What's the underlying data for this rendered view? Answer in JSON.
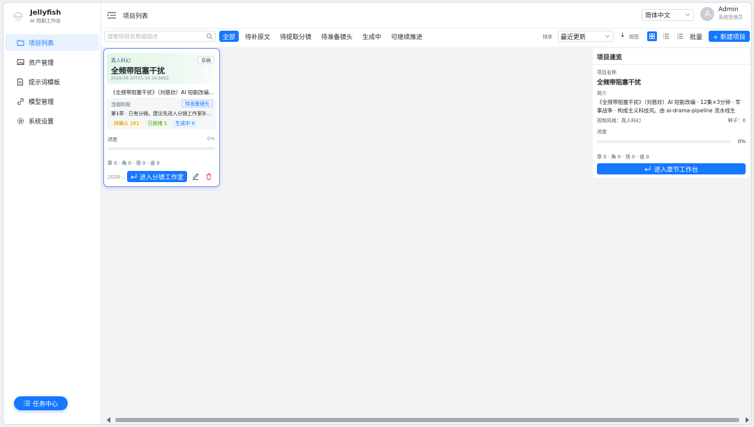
{
  "brand": {
    "name": "Jellyfish",
    "subtitle": "AI 短剧工作台"
  },
  "sidebar": {
    "items": [
      {
        "label": "项目列表",
        "icon": "folder-icon",
        "active": true
      },
      {
        "label": "资产管理",
        "icon": "image-icon",
        "active": false
      },
      {
        "label": "提示词模板",
        "icon": "document-icon",
        "active": false
      },
      {
        "label": "模型管理",
        "icon": "link-icon",
        "active": false
      },
      {
        "label": "系统设置",
        "icon": "gear-icon",
        "active": false
      }
    ],
    "task_center": "任务中心"
  },
  "header": {
    "title": "项目列表",
    "language": "简体中文",
    "user": {
      "name": "Admin",
      "role": "系统管理员"
    }
  },
  "toolbar": {
    "search_placeholder": "搜索项目名称或描述",
    "filters": [
      "全部",
      "待补原文",
      "待提取分镜",
      "待准备镜头",
      "生成中",
      "可继续推进"
    ],
    "active_filter": 0,
    "sort_label": "排序",
    "sort_value": "最近更新",
    "sort_direction": "↓",
    "view_label": "视图",
    "batch_label": "批量",
    "new_project_label": "+ 新建项目"
  },
  "project_card": {
    "genre": "真人科幻",
    "status": "草稿",
    "title": "全频带阻塞干扰",
    "date": "2026-06-20T01:14:19.869Z",
    "description": "《全频带阻塞干扰》（刘慈欣）AI 短剧改编 · 12集×3分钟 · 军事战争 · 构成主义科技风。",
    "stage_label": "当前阶段",
    "stage_badge": "待准备镜头",
    "stage_text": "第1章 · 已有分镜，建议先进入分镜工作室补充镜头",
    "chips": [
      {
        "label": "待确认 161",
        "kind": "warn"
      },
      {
        "label": "已就绪 1",
        "kind": "ok"
      },
      {
        "label": "生成中 0",
        "kind": "run"
      }
    ],
    "progress_label": "进度",
    "progress_text": "0%",
    "progress": 0,
    "stats": "章 0 · 角 0 · 场 0 · 道 0",
    "footer_date": "2026-...",
    "enter_label": "进入分镜工作室"
  },
  "quick_view": {
    "title": "项目速览",
    "name_label": "项目名称",
    "name": "全频带阻塞干扰",
    "intro_label": "简介",
    "intro": "《全频带阻塞干扰》（刘慈欣）AI 短剧改编 · 12集×3分钟 · 军事战争 · 构成主义科技风。由 ai-drama-pipeline 流水线生成：14...",
    "style_text": "视频风格：真人科幻",
    "seed_text": "种子：0",
    "progress_label": "进度",
    "progress_text": "0%",
    "progress": 0,
    "stats": "章 0 · 角 0 · 场 0 · 道 0",
    "button_label": "进入章节工作台"
  },
  "colors": {
    "accent": "#1677ff",
    "card_border": "#6d8cf0",
    "sidebar_active_bg": "#e8f2ff"
  }
}
